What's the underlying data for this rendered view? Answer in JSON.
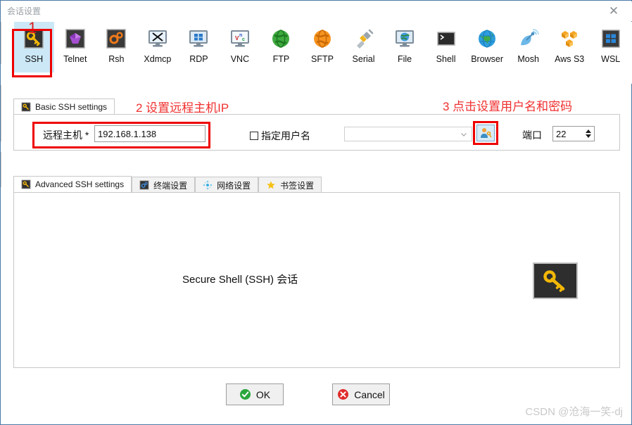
{
  "window": {
    "title": "会话设置",
    "close_label": "✕"
  },
  "protocols": [
    {
      "id": "ssh",
      "label": "SSH",
      "icon": "key-icon",
      "selected": true
    },
    {
      "id": "telnet",
      "label": "Telnet",
      "icon": "purple-gem-icon",
      "selected": false
    },
    {
      "id": "rsh",
      "label": "Rsh",
      "icon": "orange-gears-icon",
      "selected": false
    },
    {
      "id": "xdmcp",
      "label": "Xdmcp",
      "icon": "monitor-x-icon",
      "selected": false
    },
    {
      "id": "rdp",
      "label": "RDP",
      "icon": "monitor-windows-icon",
      "selected": false
    },
    {
      "id": "vnc",
      "label": "VNC",
      "icon": "monitor-vnc-icon",
      "selected": false
    },
    {
      "id": "ftp",
      "label": "FTP",
      "icon": "green-globe-icon",
      "selected": false
    },
    {
      "id": "sftp",
      "label": "SFTP",
      "icon": "orange-globe-icon",
      "selected": false
    },
    {
      "id": "serial",
      "label": "Serial",
      "icon": "serial-plug-icon",
      "selected": false
    },
    {
      "id": "file",
      "label": "File",
      "icon": "monitor-globe-icon",
      "selected": false
    },
    {
      "id": "shell",
      "label": "Shell",
      "icon": "terminal-icon",
      "selected": false
    },
    {
      "id": "browser",
      "label": "Browser",
      "icon": "blue-globe-icon",
      "selected": false
    },
    {
      "id": "mosh",
      "label": "Mosh",
      "icon": "satellite-dish-icon",
      "selected": false
    },
    {
      "id": "awss3",
      "label": "Aws S3",
      "icon": "aws-cubes-icon",
      "selected": false
    },
    {
      "id": "wsl",
      "label": "WSL",
      "icon": "windows-logo-icon",
      "selected": false
    }
  ],
  "basic_settings": {
    "tab_label": "Basic SSH settings",
    "tab_icon": "key-icon",
    "host_label": "远程主机 *",
    "host_value": "192.168.1.138",
    "host_placeholder": "",
    "specify_user_label": "指定用户名",
    "specify_user_checked": false,
    "user_combo_value": "",
    "user_combo_placeholder": "",
    "user_button_icon": "user-key-icon",
    "port_label": "端口",
    "port_value": "22"
  },
  "lower_tabs": [
    {
      "id": "advanced",
      "label": "Advanced SSH settings",
      "icon": "key-icon",
      "active": true
    },
    {
      "id": "terminal",
      "label": "终端设置",
      "icon": "gear-blue-icon",
      "active": false
    },
    {
      "id": "network",
      "label": "网络设置",
      "icon": "network-icon",
      "active": false
    },
    {
      "id": "bookmark",
      "label": "书签设置",
      "icon": "star-icon",
      "active": false
    }
  ],
  "panel": {
    "caption": "Secure Shell (SSH) 会话",
    "icon": "key-icon"
  },
  "buttons": {
    "ok_label": "OK",
    "ok_icon": "check-circle-green-icon",
    "cancel_label": "Cancel",
    "cancel_icon": "x-circle-red-icon"
  },
  "annotations": {
    "step1": "1",
    "step2": "2 设置远程主机IP",
    "step3": "3 点击设置用户名和密码",
    "color": "#ee0000"
  },
  "watermark": "CSDN @沧海一笑-dj"
}
